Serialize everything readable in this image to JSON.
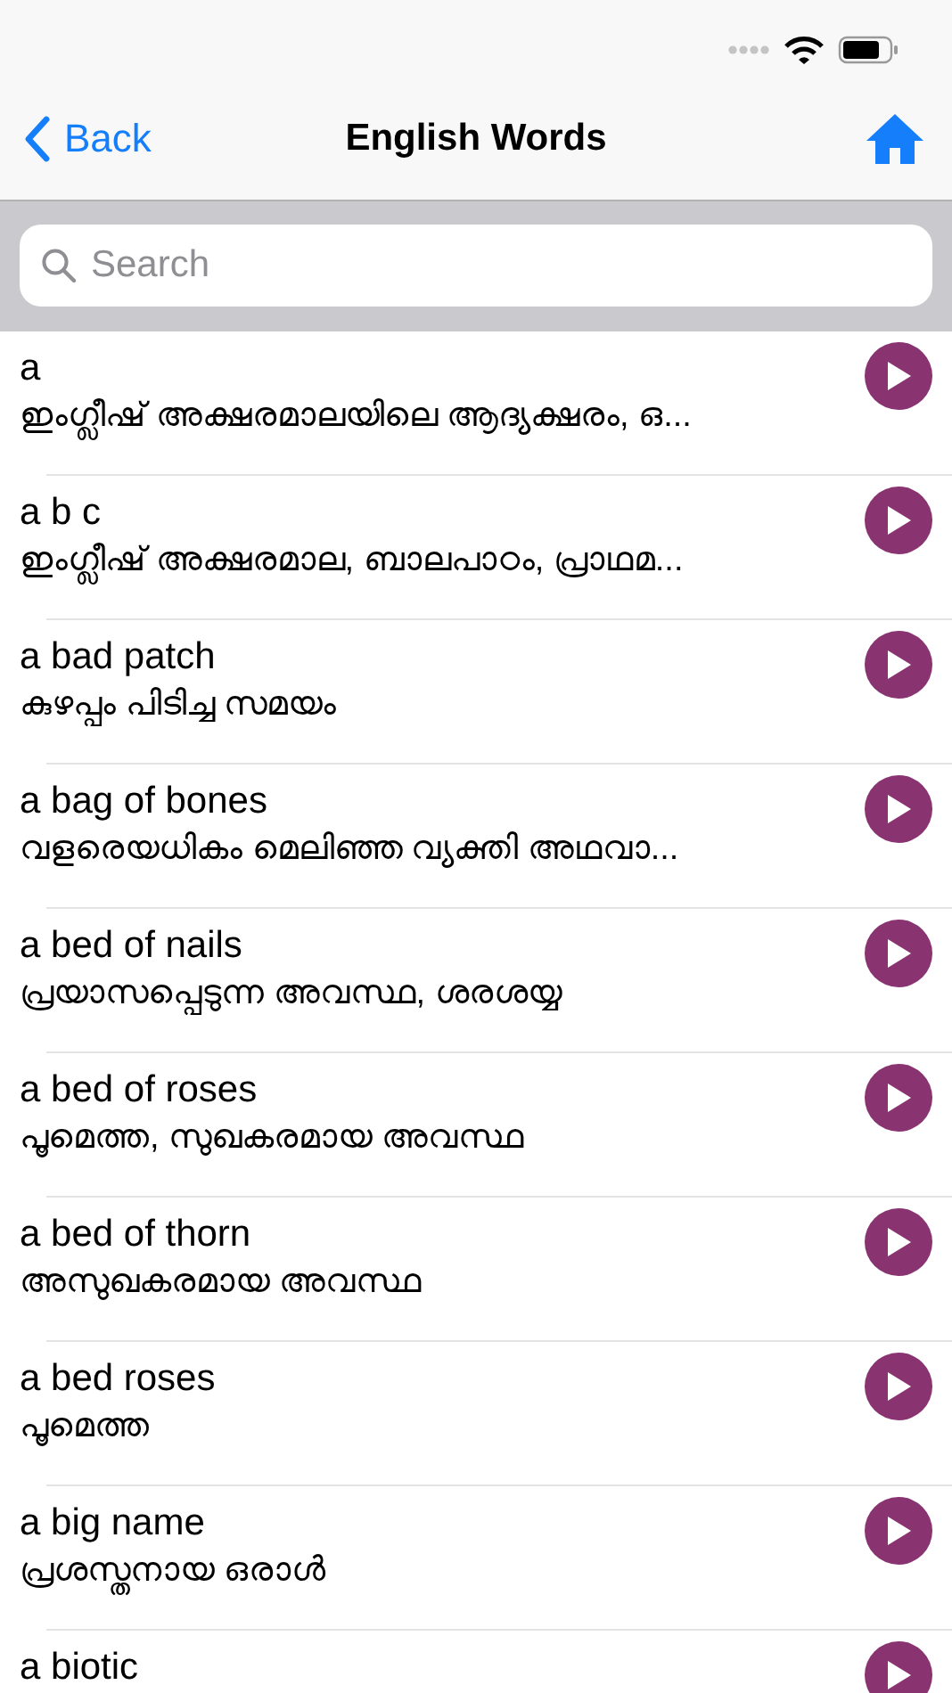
{
  "nav": {
    "back": "Back",
    "title": "English Words"
  },
  "search": {
    "placeholder": "Search"
  },
  "words": [
    {
      "word": "a",
      "meaning": "ഇംഗ്ലീഷ് അക്ഷരമാലയിലെ ആദ്യക്ഷരം, ഒ..."
    },
    {
      "word": "a b c",
      "meaning": "ഇംഗ്ലീഷ് അക്ഷരമാല, ബാലപാഠം, പ്രാഥമ..."
    },
    {
      "word": "a bad patch",
      "meaning": "കുഴപ്പം പിടിച്ച സമയം"
    },
    {
      "word": "a bag of bones",
      "meaning": "വളരെയധികം മെലിഞ്ഞ വ്യക്തി അഥവാ..."
    },
    {
      "word": "a bed of nails",
      "meaning": "പ്രയാസപ്പെടുന്ന അവസ്ഥ, ശരശയ്യ"
    },
    {
      "word": "a bed of roses",
      "meaning": "പൂമെത്ത, സുഖകരമായ അവസ്ഥ"
    },
    {
      "word": "a bed of thorn",
      "meaning": "അസുഖകരമായ അവസ്ഥ"
    },
    {
      "word": "a bed roses",
      "meaning": "പൂമെത്ത"
    },
    {
      "word": "a big name",
      "meaning": "പ്രശസ്തനായ ഒരാൾ"
    },
    {
      "word": "a biotic"
    }
  ]
}
